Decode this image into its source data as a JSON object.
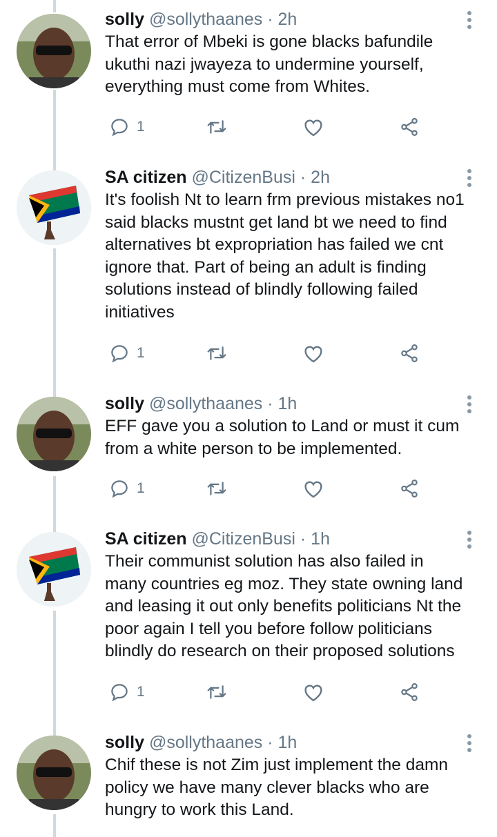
{
  "colors": {
    "icon": "#657786",
    "thread_line": "#cfd9de",
    "text": "#14171a",
    "muted": "#657786"
  },
  "tweets": [
    {
      "avatar": "solly-avatar",
      "name": "solly",
      "handle": "@sollythaanes",
      "dot": "·",
      "time": "2h",
      "lines": [
        "That error of Mbeki is gone blacks bafundile",
        "ukuthi nazi jwayeza to undermine yourself,",
        "everything must come from Whites."
      ],
      "reply_count": "1"
    },
    {
      "avatar": "sa-flag-avatar",
      "name": "SA citizen",
      "handle": "@CitizenBusi",
      "dot": "·",
      "time": "2h",
      "lines": [
        "It's foolish Nt to learn frm previous mistakes no1",
        "said blacks mustnt get land bt we need to find",
        "alternatives bt expropriation has failed we cnt",
        "ignore that. Part of being an adult is finding",
        "solutions instead of blindly following failed",
        "initiatives"
      ],
      "reply_count": "1"
    },
    {
      "avatar": "solly-avatar",
      "name": "solly",
      "handle": "@sollythaanes",
      "dot": "·",
      "time": "1h",
      "lines": [
        "EFF gave you a solution to Land or must it cum",
        "from a white person to be implemented."
      ],
      "reply_count": "1"
    },
    {
      "avatar": "sa-flag-avatar",
      "name": "SA citizen",
      "handle": "@CitizenBusi",
      "dot": "·",
      "time": "1h",
      "lines": [
        "Their communist solution has also failed in",
        "many countries eg moz. They state owning land",
        "and leasing it out only benefits politicians Nt the",
        "poor again I tell you before follow politicians",
        "blindly do research on their proposed solutions"
      ],
      "reply_count": "1"
    },
    {
      "avatar": "solly-avatar",
      "name": "solly",
      "handle": "@sollythaanes",
      "dot": "·",
      "time": "1h",
      "lines": [
        "Chif these is not Zim just implement the damn",
        "policy we have many clever blacks who are",
        "hungry to work this Land."
      ],
      "reply_count": ""
    }
  ]
}
